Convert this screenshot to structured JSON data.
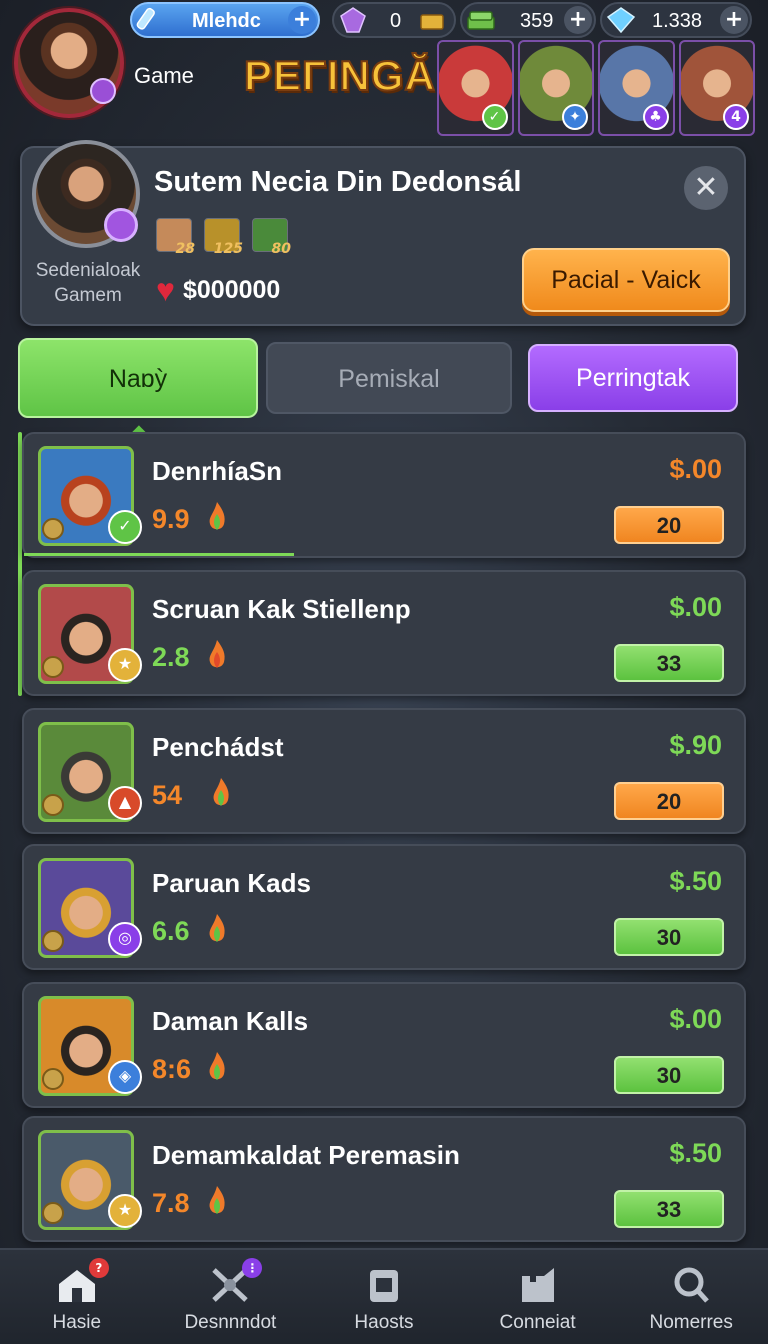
{
  "header": {
    "game_label": "Game",
    "banner_title": "PEГINGĂR",
    "resources": {
      "blue_label": "Mlehdc",
      "gems": "0",
      "cash": "359",
      "crystals": "1.338"
    },
    "heroes": [
      {
        "badge": "✓",
        "bg": "#c93a3a",
        "badge_color": "#5fc446"
      },
      {
        "badge": "✦",
        "bg": "#6f8a3a",
        "badge_color": "#3c7fdb"
      },
      {
        "badge": "♣",
        "bg": "#5876a8",
        "badge_color": "#8a3fe8"
      },
      {
        "badge": "4",
        "bg": "#a0543a",
        "badge_color": "#8a3fe8"
      }
    ]
  },
  "profile": {
    "name": "Sutem Necia Din Dedonsál",
    "subtitle_line1": "Sedenialoak",
    "subtitle_line2": "Gamem",
    "items": [
      {
        "label": "28",
        "color": "#c58a5a"
      },
      {
        "label": "125",
        "color": "#b8912a"
      },
      {
        "label": "80",
        "color": "#4a8a3a"
      }
    ],
    "coins": "$000000",
    "action_label": "Pacial - Vaick",
    "close_icon": "close-icon"
  },
  "tabs": [
    {
      "label": "Naɒỳ"
    },
    {
      "label": "Pemiskal"
    },
    {
      "label": "Perringtak"
    }
  ],
  "players": [
    {
      "name": "DenrhíaSn",
      "rating": "9.9",
      "rating_color": "orange",
      "price": "$.00",
      "price_color": "orange",
      "count": "20",
      "count_color": "orange",
      "portrait_bg": "#3a7ac0",
      "hair": "#b8421e",
      "badge": "✓",
      "badge_bg": "#5fc446",
      "flame": "#5fc446"
    },
    {
      "name": "Scruan Kak Stiellenp",
      "rating": "2.8",
      "rating_color": "green",
      "price": "$.00",
      "price_color": "green",
      "count": "33",
      "count_color": "green",
      "portrait_bg": "#b24a4a",
      "hair": "#2a2420",
      "badge": "★",
      "badge_bg": "#e3b23a",
      "flame": "#e24a2a"
    },
    {
      "name": "Penchádst",
      "rating": "54",
      "rating_color": "orange",
      "price": "$.90",
      "price_color": "green",
      "count": "20",
      "count_color": "orange",
      "portrait_bg": "#5a8a3a",
      "hair": "#3a3a36",
      "badge": "▲",
      "badge_bg": "#d84a2a",
      "flame": "#5fc446"
    },
    {
      "name": "Paruan Kads",
      "rating": "6.6",
      "rating_color": "green",
      "price": "$.50",
      "price_color": "green",
      "count": "30",
      "count_color": "green",
      "portrait_bg": "#5a4a9a",
      "hair": "#d8a032",
      "badge": "◎",
      "badge_bg": "#8a3fe8",
      "flame": "#5fc446"
    },
    {
      "name": "Daman Kalls",
      "rating": "8:6",
      "rating_color": "orange",
      "price": "$.00",
      "price_color": "green",
      "count": "30",
      "count_color": "green",
      "portrait_bg": "#d88a2a",
      "hair": "#2a2420",
      "badge": "◈",
      "badge_bg": "#3c7fdb",
      "flame": "#5fc446"
    },
    {
      "name": "Demamkaldat Peremasin",
      "rating": "7.8",
      "rating_color": "orange",
      "price": "$.50",
      "price_color": "green",
      "count": "33",
      "count_color": "green",
      "portrait_bg": "#4a5a6a",
      "hair": "#d8a032",
      "badge": "★",
      "badge_bg": "#e3b23a",
      "flame": "#5fc446"
    }
  ],
  "bottom_nav": [
    {
      "label": "Hasie",
      "icon": "home-icon",
      "dot": "?"
    },
    {
      "label": "Desnnndot",
      "icon": "crossed-swords-icon",
      "dot": "⋮"
    },
    {
      "label": "Haosts",
      "icon": "clipboard-icon",
      "dot": ""
    },
    {
      "label": "Conneiat",
      "icon": "castle-icon",
      "dot": ""
    },
    {
      "label": "Nomerres",
      "icon": "search-icon",
      "dot": ""
    }
  ]
}
